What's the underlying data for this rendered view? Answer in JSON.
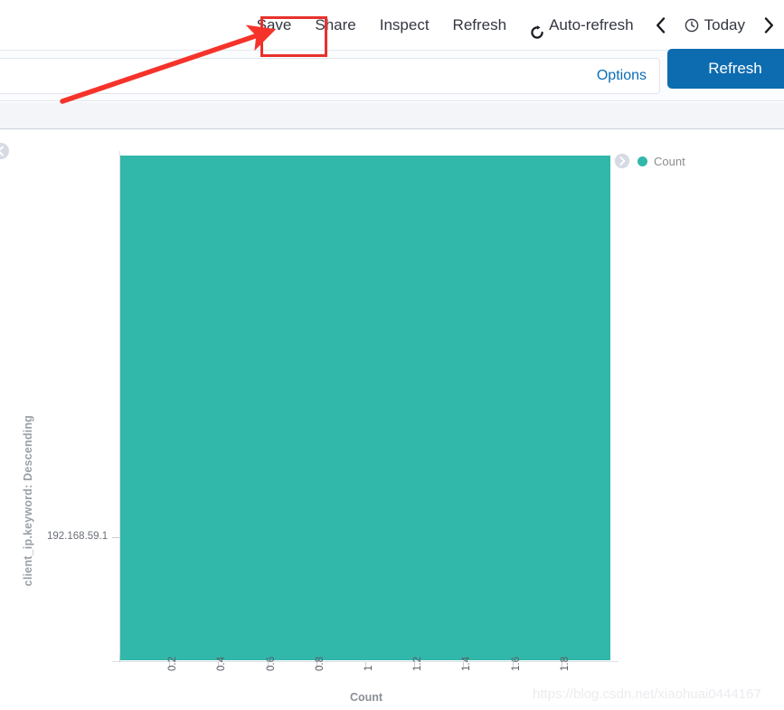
{
  "toolbar": {
    "items": [
      {
        "label": "Save",
        "icon": null,
        "name": "save-button"
      },
      {
        "label": "Share",
        "icon": null,
        "name": "share-button"
      },
      {
        "label": "Inspect",
        "icon": null,
        "name": "inspect-button"
      },
      {
        "label": "Refresh",
        "icon": null,
        "name": "toolbar-refresh-button"
      },
      {
        "label": "Auto-refresh",
        "icon": "refresh-cycle-icon",
        "name": "auto-refresh-button"
      }
    ],
    "prev_label": "‹",
    "next_label": "›",
    "today_label": "Today",
    "clock_icon": "clock-icon"
  },
  "query": {
    "value": "",
    "placeholder": "",
    "options_label": "Options",
    "refresh_label": "Refresh"
  },
  "chart_panel": {
    "collapse_left_icon": "chevron-left-circle-icon",
    "legend_toggle_icon": "chevron-right-circle-icon",
    "legend": [
      {
        "label": "Count",
        "color": "#32b7ab"
      }
    ]
  },
  "colors": {
    "bar": "#32b7ab",
    "accent_blue": "#0d6cb0",
    "link_blue": "#0b6cb5",
    "annotation_red": "#e8312b",
    "text_dark": "#343741",
    "axis_grey": "#dcdfe4"
  },
  "watermark": {
    "text": "https://blog.csdn.net/xiaohuai0444167"
  },
  "chart_data": {
    "type": "bar",
    "orientation": "horizontal",
    "title": "",
    "xlabel": "Count",
    "ylabel": "client_ip.keyword: Descending",
    "categories": [
      "192.168.59.1"
    ],
    "values": [
      2
    ],
    "series": [
      {
        "name": "Count",
        "values": [
          2
        ],
        "color": "#32b7ab"
      }
    ],
    "xlim": [
      0,
      2
    ],
    "xticks": [
      "0.2",
      "0.4",
      "0.6",
      "0.8",
      "1",
      "1.2",
      "1.4",
      "1.6",
      "1.8"
    ],
    "xtick_values": [
      0.2,
      0.4,
      0.6,
      0.8,
      1,
      1.2,
      1.4,
      1.6,
      1.8
    ],
    "xtick_rotation": -90,
    "yticks": [
      "192.168.59.1"
    ],
    "grid": false,
    "legend_position": "right",
    "legend_entries": [
      "Count"
    ]
  }
}
